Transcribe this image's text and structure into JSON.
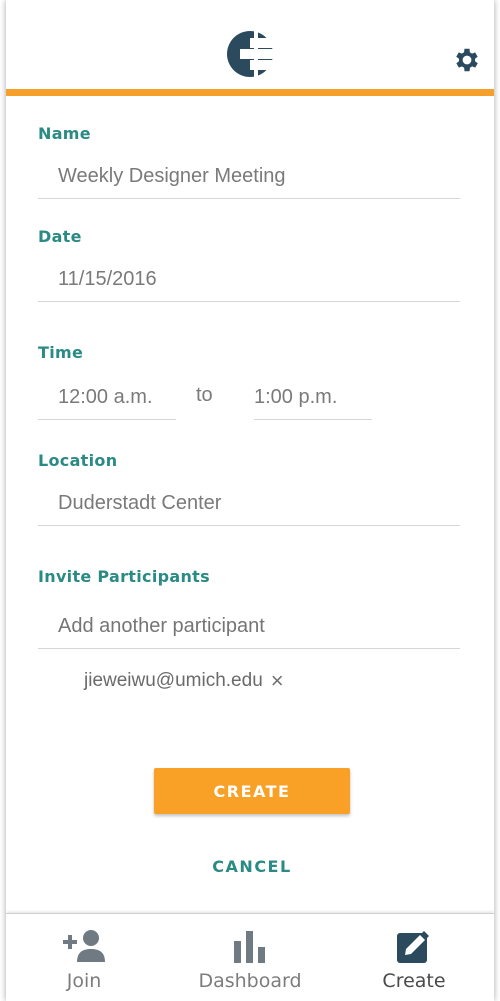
{
  "colors": {
    "accent": "#f5a02a",
    "label_teal": "#2a8a84",
    "logo_navy": "#2b4a5e"
  },
  "header": {
    "logo_icon": "app-logo-icon",
    "settings_icon": "gear-icon"
  },
  "form": {
    "name": {
      "label": "Name",
      "value": "Weekly Designer Meeting"
    },
    "date": {
      "label": "Date",
      "value": "11/15/2016"
    },
    "time": {
      "label": "Time",
      "start": "12:00 a.m.",
      "separator": "to",
      "end": "1:00 p.m."
    },
    "location": {
      "label": "Location",
      "value": "Duderstadt Center"
    },
    "participants": {
      "label": "Invite Participants",
      "placeholder": "Add another participant",
      "invited": [
        "jieweiwu@umich.edu"
      ],
      "remove_glyph": "×"
    }
  },
  "actions": {
    "create_label": "CREATE",
    "cancel_label": "CANCEL"
  },
  "bottom_nav": {
    "items": [
      {
        "label": "Join",
        "icon": "add-person-icon",
        "active": false
      },
      {
        "label": "Dashboard",
        "icon": "bar-chart-icon",
        "active": false
      },
      {
        "label": "Create",
        "icon": "edit-icon",
        "active": true
      }
    ]
  }
}
